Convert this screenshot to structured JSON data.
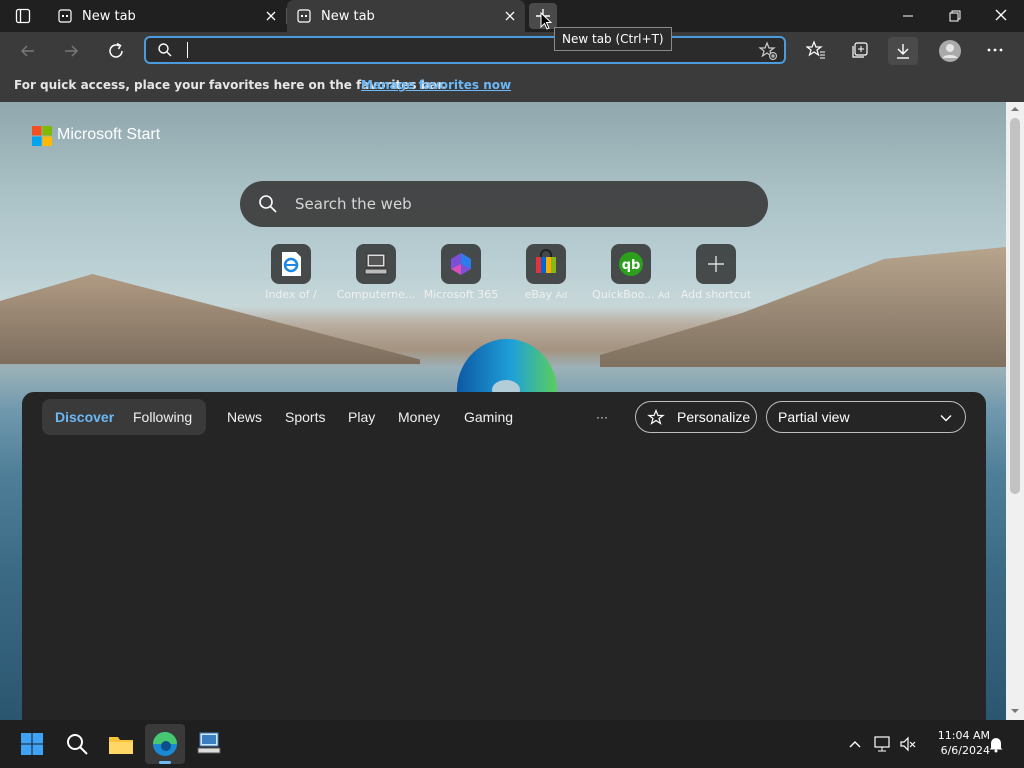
{
  "browser": {
    "tabs": [
      {
        "label": "New tab"
      },
      {
        "label": "New tab"
      }
    ],
    "tooltip": "New tab (Ctrl+T)",
    "address": {
      "value": "",
      "placeholder": ""
    },
    "favorites_bar": {
      "text": "For quick access, place your favorites here on the favorites bar.",
      "link": "Manage favorites now"
    }
  },
  "page": {
    "brand": "Microsoft Start",
    "search_placeholder": "Search the web",
    "shortcuts": [
      {
        "label": "Index of /",
        "icon": "ie-doc-icon"
      },
      {
        "label": "Computerne...",
        "icon": "computer-icon"
      },
      {
        "label": "Microsoft 365",
        "icon": "m365-icon"
      },
      {
        "label": "eBay",
        "ad": "Ad",
        "icon": "ebay-bag-icon"
      },
      {
        "label": "QuickBoo...",
        "ad": "Ad",
        "icon": "quickbooks-icon"
      },
      {
        "label": "Add shortcut",
        "icon": "plus-icon"
      }
    ],
    "feed_nav": {
      "discover": "Discover",
      "following": "Following",
      "items": [
        "News",
        "Sports",
        "Play",
        "Money",
        "Gaming"
      ],
      "more": "···",
      "personalize": "Personalize",
      "view": "Partial view"
    }
  },
  "taskbar": {
    "time": "11:04 AM",
    "date": "6/6/2024"
  },
  "colors": {
    "accent": "#4c9bdc",
    "link": "#6cb8f6",
    "discover_active": "#6cb8f6"
  }
}
